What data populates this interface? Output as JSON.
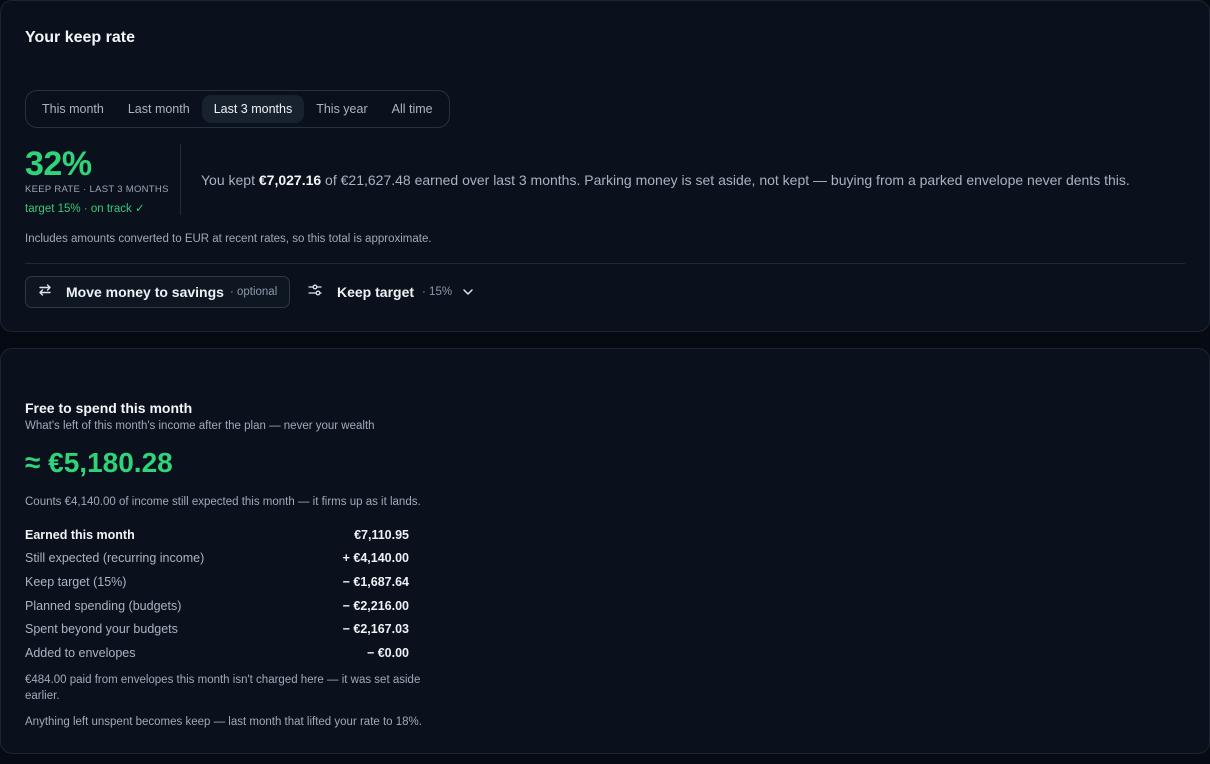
{
  "keep_rate": {
    "title": "Your keep rate",
    "tabs": [
      "This month",
      "Last month",
      "Last 3 months",
      "This year",
      "All time"
    ],
    "active_tab": "Last 3 months",
    "rate_percent": "32%",
    "rate_label": "KEEP RATE · LAST 3 MONTHS",
    "target_status": "target 15% · on track ✓",
    "kept_prefix": "You kept ",
    "kept_amount": "€7,027.16",
    "kept_suffix": " of €21,627.48 earned over last 3 months. Parking money is set aside, not kept — buying from a parked envelope never dents this.",
    "fx_note": "Includes amounts converted to EUR at recent rates, so this total is approximate.",
    "move_button": {
      "label": "Move money to savings",
      "suffix": "· optional"
    },
    "target_button": {
      "label": "Keep target",
      "value": "· 15%"
    },
    "accent_color": "#2fd47a"
  },
  "free_to_spend": {
    "title": "Free to spend this month",
    "subtitle": "What's left of this month's income after the plan — never your wealth",
    "amount": "≈ €5,180.28",
    "counts_note": "Counts €4,140.00 of income still expected this month — it firms up as it lands.",
    "rows": [
      {
        "label": "Earned this month",
        "value": "€7,110.95"
      },
      {
        "label": "Still expected (recurring income)",
        "value": "+ €4,140.00"
      },
      {
        "label": "Keep target (15%)",
        "value": "− €1,687.64"
      },
      {
        "label": "Planned spending (budgets)",
        "value": "− €2,216.00"
      },
      {
        "label": "Spent beyond your budgets",
        "value": "− €2,167.03"
      },
      {
        "label": "Added to envelopes",
        "value": "− €0.00"
      }
    ],
    "envelope_note": "€484.00 paid from envelopes this month isn't charged here — it was set aside earlier.",
    "unspent_note": "Anything left unspent becomes keep — last month that lifted your rate to 18%."
  },
  "icons": [
    "swap-arrows-icon",
    "sliders-icon",
    "chevron-down-icon"
  ]
}
